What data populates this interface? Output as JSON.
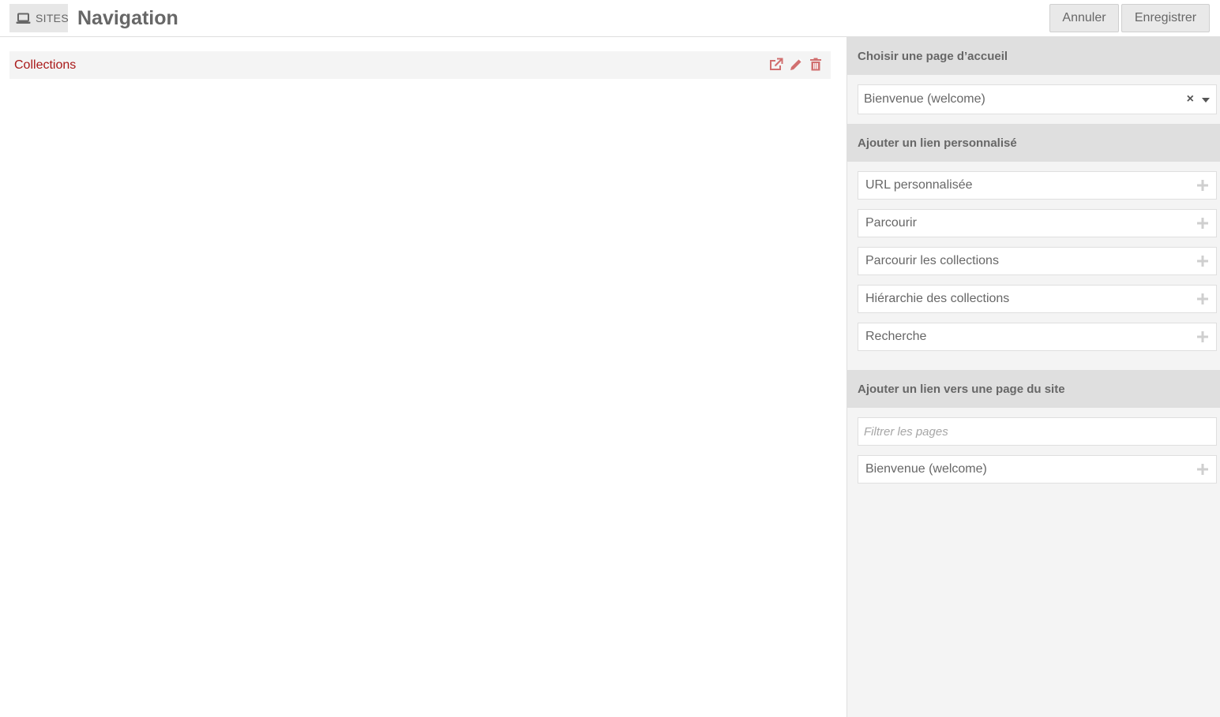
{
  "header": {
    "breadcrumb_label": "SITES",
    "breadcrumb_icon": "laptop-icon",
    "title": "Navigation",
    "cancel_label": "Annuler",
    "save_label": "Enregistrer"
  },
  "main": {
    "nav_items": [
      {
        "label": "Collections",
        "icons": [
          "external-link-icon",
          "pencil-icon",
          "trash-icon"
        ]
      }
    ]
  },
  "sidebar": {
    "homepage": {
      "heading": "Choisir une page d’accueil",
      "selected": "Bienvenue (welcome)",
      "clear_glyph": "×"
    },
    "custom_links": {
      "heading": "Ajouter un lien personnalisé",
      "items": [
        "URL personnalisée",
        "Parcourir",
        "Parcourir les collections",
        "Hiérarchie des collections",
        "Recherche"
      ]
    },
    "site_pages": {
      "heading": "Ajouter un lien vers une page du site",
      "filter_placeholder": "Filtrer les pages",
      "items": [
        "Bienvenue (welcome)"
      ]
    }
  },
  "colors": {
    "accent": "#a91919",
    "icon_red": "#d16f6f",
    "text": "#676767",
    "panel_bg": "#f4f4f4",
    "section_bg": "#dfdfdf"
  }
}
